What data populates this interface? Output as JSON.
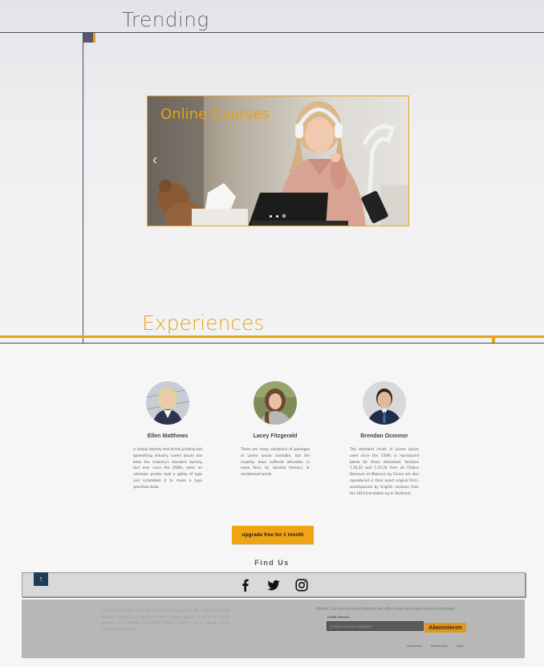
{
  "trending": {
    "title": "Trending"
  },
  "slider": {
    "title": "Online Courses",
    "prev_arrow": "‹",
    "next_arrow": "›",
    "slide_count": 3,
    "active_slide": 3
  },
  "experiences": {
    "title": "Experiences"
  },
  "people": [
    {
      "name": "Ellen Matthews",
      "bio": "is simply dummy text of the printing and typesetting industry. Lorem Ipsum has been the industry's standard dummy text ever since the 1500s, when an unknown printer took a galley of type and scrambled it to make a type specimen book."
    },
    {
      "name": "Lacey Fitzgerald",
      "bio": "There are many variations of passages of Lorem Ipsum available, but the majority have suffered alteration in some form, by injected humour, or randomised words."
    },
    {
      "name": "Brendan Oconnor",
      "bio": "The standard chunk of Lorem Ipsum used since the 1500s is reproduced below for those interested. Sections 1.10.32 and 1.10.33 from de Finibus Bonorum et Malorum by Cicero are also reproduced in their exact original form, accompanied by English versions from the 1914 translation by H. Rackham."
    }
  ],
  "cta": {
    "label": "upgrade free for 1 month"
  },
  "find_us": {
    "title": "Find Us"
  },
  "social": {
    "icons": [
      "facebook-icon",
      "twitter-icon",
      "instagram-icon"
    ]
  },
  "scroll_top": {
    "label": "↑"
  },
  "footer": {
    "lorem": "Lorem ipsum dolor sit amet, consectetur adipiscing elit, sed do eiusmod tempor incididunt ut labore et dolore magna aliqua. Ut enim ad minim veniam, quis nostrud exercitation ullamco laboris nisi ut aliquip ex ea commodo consequat.",
    "newsletter_heading": "Melden Sie sich an und erfahren Sie alles rund um unsere neue Homepage",
    "email_label": "E-Mail-Adresse",
    "email_placeholder": "E-Mail-Adresse eingeben*",
    "subscribe_label": "Abonnieren",
    "links": [
      "Impressum",
      "Datenschutz",
      "AGB"
    ]
  },
  "colors": {
    "accent": "#e9a21a",
    "dark_line": "#4a4a60",
    "scroll_top_bg": "#1f3d57"
  }
}
